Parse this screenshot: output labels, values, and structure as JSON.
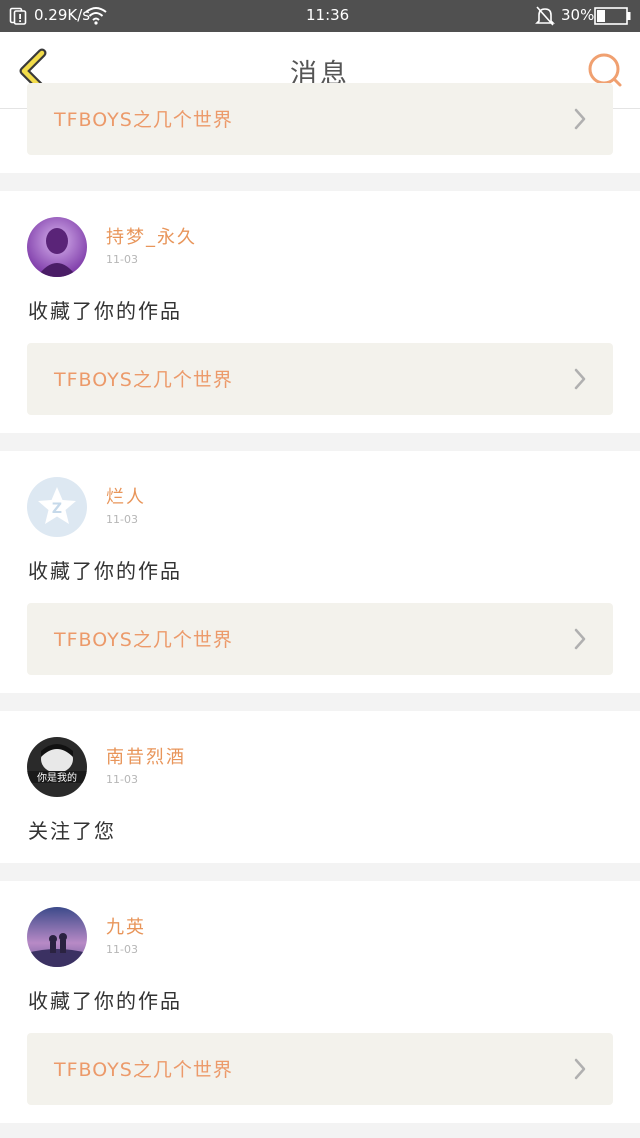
{
  "status_bar": {
    "speed": "0.29K/s",
    "time": "11:36",
    "battery": "30%",
    "battery_level": 0.3,
    "icons": [
      "sim-alert-icon",
      "wifi-icon",
      "mute-bell-icon",
      "battery-icon"
    ]
  },
  "header": {
    "title": "消息",
    "back_icon": "chevron-left-icon",
    "search_icon": "search-icon",
    "accent": "#f0a070"
  },
  "messages": [
    {
      "work_title": "TFBOYS之几个世界"
    },
    {
      "user": "持梦_永久",
      "date": "11-03",
      "action": "收藏了你的作品",
      "work_title": "TFBOYS之几个世界"
    },
    {
      "user": "烂人",
      "date": "11-03",
      "action": "收藏了你的作品",
      "work_title": "TFBOYS之几个世界"
    },
    {
      "user": "南昔烈酒",
      "date": "11-03",
      "action": "关注了您",
      "avatar_text": "你是我的"
    },
    {
      "user": "九英",
      "date": "11-03",
      "action": "收藏了你的作品",
      "work_title": "TFBOYS之几个世界"
    }
  ],
  "colors": {
    "name": "#e8955a",
    "work_title": "#ec9a6a",
    "card_bg": "#f3f2ec",
    "page_bg": "#f3f3f3",
    "status_bg": "#505050"
  }
}
